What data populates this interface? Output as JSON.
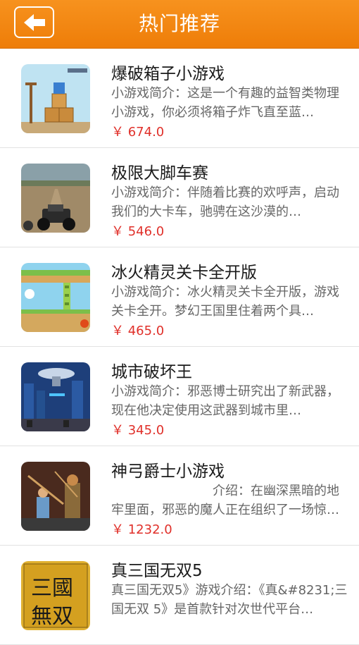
{
  "header": {
    "title": "热门推荐",
    "back_icon": "back-arrow-icon",
    "color": "#f28712"
  },
  "games": [
    {
      "title": "爆破箱子小游戏",
      "description": "小游戏简介：这是一个有趣的益智类物理小游戏，你必须将箱子炸飞直至蓝…",
      "price": "￥ 674.0",
      "thumb": "box-blast-thumbnail"
    },
    {
      "title": "极限大脚车赛",
      "description": "小游戏简介：伴随着比赛的欢呼声，启动我们的大卡车，驰骋在这沙漠的…",
      "price": "￥ 546.0",
      "thumb": "monster-truck-thumbnail"
    },
    {
      "title": "冰火精灵关卡全开版",
      "description": "小游戏简介：冰火精灵关卡全开版，游戏关卡全开。梦幻王国里住着两个具…",
      "price": "￥ 465.0",
      "thumb": "fire-ice-thumbnail"
    },
    {
      "title": "城市破坏王",
      "description": "小游戏简介：邪恶博士研究出了新武器，现在他决定使用这武器到城市里…",
      "price": "￥ 345.0",
      "thumb": "city-destroyer-thumbnail"
    },
    {
      "title": "神弓爵士小游戏",
      "description": "　　　　　　　　介绍：在幽深黑暗的地牢里面，邪恶的魔人正在组织了一场惊…",
      "price": "￥ 1232.0",
      "thumb": "archer-thumbnail"
    },
    {
      "title": "真三国无双5",
      "description": "真三国无双5》游戏介绍：《真&#8231;三国无双 5》是首款针对次世代平台…",
      "price": "",
      "thumb": "dynasty-warriors-thumbnail"
    }
  ]
}
